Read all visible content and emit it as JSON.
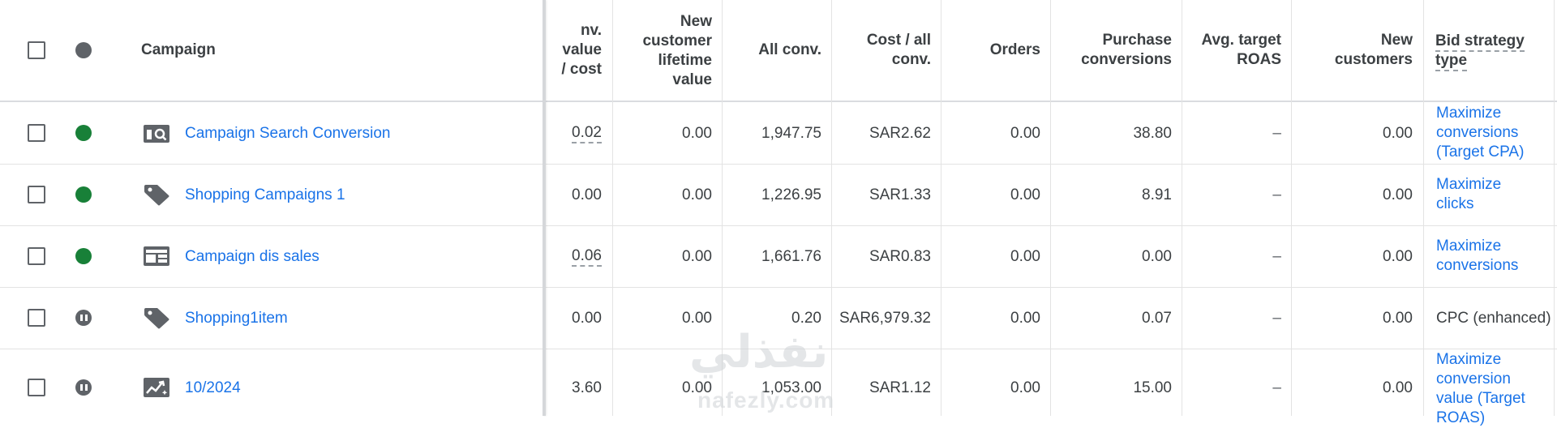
{
  "header": {
    "campaign": "Campaign",
    "conv_value_cost": [
      "nv. value",
      "/ cost"
    ],
    "new_customer_lifetime_value": [
      "New",
      "customer",
      "lifetime",
      "value"
    ],
    "all_conv": "All conv.",
    "cost_all_conv": [
      "Cost / all",
      "conv."
    ],
    "orders": "Orders",
    "purchase_conversions": [
      "Purchase",
      "conversions"
    ],
    "avg_target_roas": [
      "Avg. target",
      "ROAS"
    ],
    "new_customers": [
      "New",
      "customers"
    ],
    "bid_strategy_type": [
      "Bid strategy",
      "type"
    ]
  },
  "rows": [
    {
      "status": "enabled",
      "type_icon": "search-campaign-icon",
      "name": "Campaign Search Conversion",
      "conv_value_cost": "0.02",
      "nclv": "0.00",
      "all_conv": "1,947.75",
      "cost_all_conv": "SAR2.62",
      "orders": "0.00",
      "purchase_conv": "38.80",
      "avg_target_roas": "–",
      "new_customers": "0.00",
      "bid_strategy": [
        "Maximize",
        "conversions",
        "(Target CPA)"
      ]
    },
    {
      "status": "enabled",
      "type_icon": "shopping-tag-icon",
      "name": "Shopping Campaigns 1",
      "conv_value_cost": "0.00",
      "nclv": "0.00",
      "all_conv": "1,226.95",
      "cost_all_conv": "SAR1.33",
      "orders": "0.00",
      "purchase_conv": "8.91",
      "avg_target_roas": "–",
      "new_customers": "0.00",
      "bid_strategy": [
        "Maximize",
        "clicks"
      ]
    },
    {
      "status": "enabled",
      "type_icon": "display-campaign-icon",
      "name": "Campaign dis sales",
      "conv_value_cost": "0.06",
      "nclv": "0.00",
      "all_conv": "1,661.76",
      "cost_all_conv": "SAR0.83",
      "orders": "0.00",
      "purchase_conv": "0.00",
      "avg_target_roas": "–",
      "new_customers": "0.00",
      "bid_strategy": [
        "Maximize",
        "conversions"
      ]
    },
    {
      "status": "paused",
      "type_icon": "shopping-tag-icon",
      "name": "Shopping1item",
      "conv_value_cost": "0.00",
      "nclv": "0.00",
      "all_conv": "0.20",
      "cost_all_conv": "SAR6,979.32",
      "orders": "0.00",
      "purchase_conv": "0.07",
      "avg_target_roas": "–",
      "new_customers": "0.00",
      "bid_strategy": [
        "CPC (enhanced)"
      ]
    },
    {
      "status": "paused",
      "type_icon": "performance-max-icon",
      "name": "10/2024",
      "conv_value_cost": "3.60",
      "nclv": "0.00",
      "all_conv": "1,053.00",
      "cost_all_conv": "SAR1.12",
      "orders": "0.00",
      "purchase_conv": "15.00",
      "avg_target_roas": "–",
      "new_customers": "0.00",
      "bid_strategy": [
        "Maximize",
        "conversion",
        "value (Target",
        "ROAS)"
      ]
    }
  ],
  "watermark": {
    "arabic": "نفذلي",
    "latin": "nafezly.com"
  }
}
